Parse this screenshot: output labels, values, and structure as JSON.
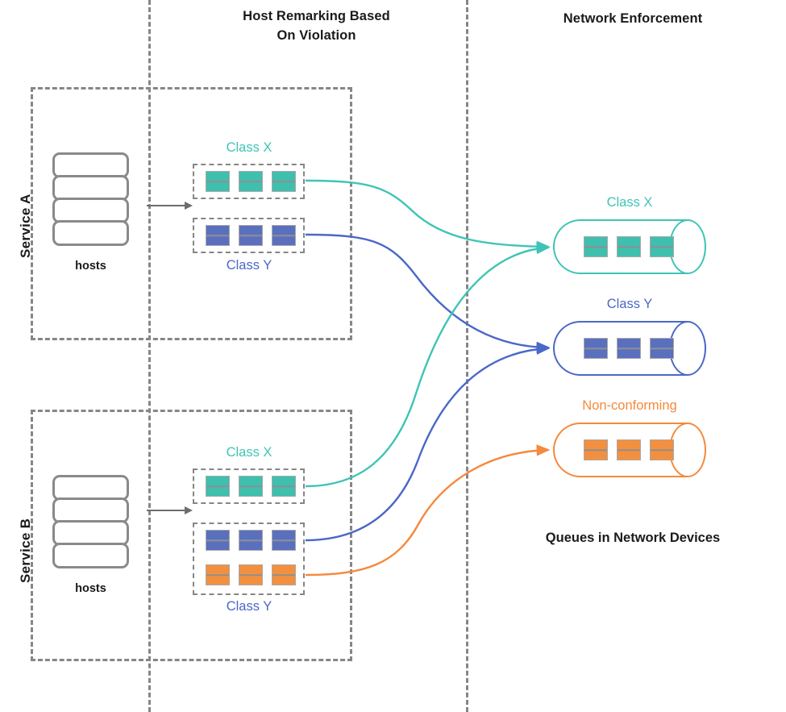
{
  "headings": {
    "remarking": "Host Remarking Based\nOn Violation",
    "remarking_line1": "Host Remarking Based",
    "remarking_line2": "On Violation",
    "enforcement": "Network Enforcement",
    "queues_in_devices": "Queues in Network Devices"
  },
  "colors": {
    "class_x": "#3ec4b6",
    "class_y": "#4a68c8",
    "non_conforming": "#f5893c",
    "packet_teal": "#3fbfae",
    "packet_blue": "#5a70bf",
    "packet_orange": "#f2903f",
    "dashed_gray": "#868686",
    "host_gray": "#8a8a8a",
    "text": "#1a1a1a"
  },
  "services": [
    {
      "id": "a",
      "label": "Service A",
      "hosts_caption": "hosts",
      "host_units": 4,
      "class_groups": [
        {
          "id": "a-x",
          "label": "Class X",
          "label_position": "above",
          "color_name": "class_x",
          "packet_rows": [
            {
              "color_name": "packet_teal",
              "count": 3
            }
          ]
        },
        {
          "id": "a-y",
          "label": "Class Y",
          "label_position": "below",
          "color_name": "class_y",
          "packet_rows": [
            {
              "color_name": "packet_blue",
              "count": 3
            }
          ]
        }
      ]
    },
    {
      "id": "b",
      "label": "Service B",
      "hosts_caption": "hosts",
      "host_units": 4,
      "class_groups": [
        {
          "id": "b-x",
          "label": "Class X",
          "label_position": "above",
          "color_name": "class_x",
          "packet_rows": [
            {
              "color_name": "packet_teal",
              "count": 3
            }
          ]
        },
        {
          "id": "b-y",
          "label": "Class Y",
          "label_position": "below",
          "color_name": "class_y",
          "packet_rows": [
            {
              "color_name": "packet_blue",
              "count": 3
            },
            {
              "color_name": "packet_orange",
              "count": 3
            }
          ]
        }
      ]
    }
  ],
  "queues": [
    {
      "id": "x",
      "label": "Class X",
      "color_name": "class_x",
      "packet_color_name": "packet_teal",
      "packet_count": 3
    },
    {
      "id": "y",
      "label": "Class Y",
      "color_name": "class_y",
      "packet_color_name": "packet_blue",
      "packet_count": 3
    },
    {
      "id": "nc",
      "label": "Non-conforming",
      "color_name": "non_conforming",
      "packet_color_name": "packet_orange",
      "packet_count": 3
    }
  ],
  "connections": [
    {
      "from": "service-a-class-x",
      "to": "queue-class-x",
      "color_name": "class_x"
    },
    {
      "from": "service-a-class-y",
      "to": "queue-class-y",
      "color_name": "class_y"
    },
    {
      "from": "service-b-class-x",
      "to": "queue-class-x",
      "color_name": "class_x"
    },
    {
      "from": "service-b-class-y",
      "to": "queue-class-y",
      "color_name": "class_y"
    },
    {
      "from": "service-b-nonconforming",
      "to": "queue-non-conforming",
      "color_name": "non_conforming"
    }
  ]
}
